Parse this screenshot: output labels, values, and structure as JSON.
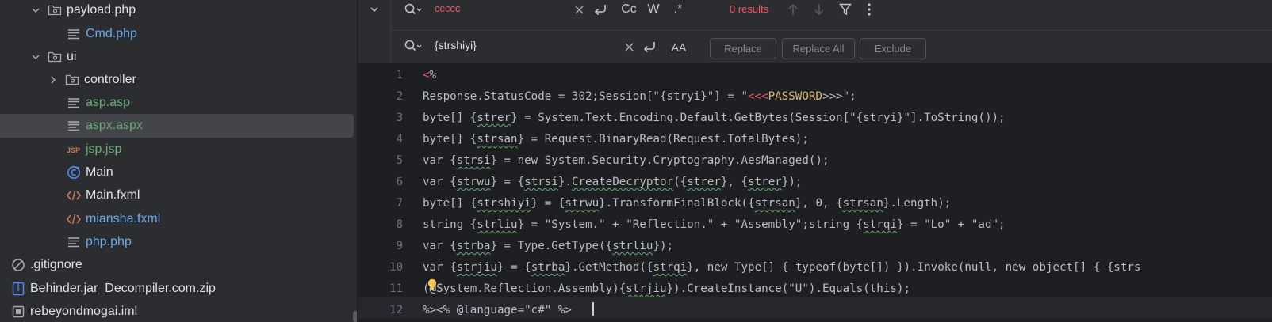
{
  "tree": {
    "items": [
      {
        "label": "payload.php",
        "kind": "folder",
        "expanded": true,
        "indent": 1,
        "color": "default"
      },
      {
        "label": "Cmd.php",
        "kind": "text-file",
        "indent": 2,
        "color": "blue"
      },
      {
        "label": "ui",
        "kind": "folder",
        "expanded": true,
        "indent": 1,
        "color": "default"
      },
      {
        "label": "controller",
        "kind": "folder",
        "expanded": false,
        "indent": 2,
        "color": "default"
      },
      {
        "label": "asp.asp",
        "kind": "text-file",
        "indent": 2,
        "color": "green"
      },
      {
        "label": "aspx.aspx",
        "kind": "text-file",
        "indent": 2,
        "color": "green",
        "selected": true
      },
      {
        "label": "jsp.jsp",
        "kind": "jsp-file",
        "indent": 2,
        "color": "green"
      },
      {
        "label": "Main",
        "kind": "java-class",
        "indent": 2,
        "color": "default"
      },
      {
        "label": "Main.fxml",
        "kind": "xml-file",
        "indent": 2,
        "color": "default"
      },
      {
        "label": "miansha.fxml",
        "kind": "xml-file",
        "indent": 2,
        "color": "blue"
      },
      {
        "label": "php.php",
        "kind": "text-file",
        "indent": 2,
        "color": "blue"
      },
      {
        "label": ".gitignore",
        "kind": "ignore-file",
        "indent": 0,
        "color": "default"
      },
      {
        "label": "Behinder.jar_Decompiler.com.zip",
        "kind": "zip-file",
        "indent": 0,
        "color": "default"
      },
      {
        "label": "rebeyondmogai.iml",
        "kind": "module-file",
        "indent": 0,
        "color": "default"
      }
    ]
  },
  "find": {
    "search_value": "ccccc",
    "replace_value": "{strshiyi}",
    "results_text": "0 results",
    "toggle_case": "Cc",
    "toggle_word": "W",
    "toggle_regex": ".*",
    "toggle_preserve_case": "AA",
    "replace_label": "Replace",
    "replace_all_label": "Replace All",
    "exclude_label": "Exclude"
  },
  "editor": {
    "line_numbers": [
      "1",
      "2",
      "3",
      "4",
      "5",
      "6",
      "7",
      "8",
      "9",
      "10",
      "11",
      "12"
    ],
    "colors": {
      "accent_red": "#f75464",
      "string_orange": "#d5b778",
      "tree_green": "#6aab73",
      "tree_blue": "#6ea9e8"
    }
  }
}
